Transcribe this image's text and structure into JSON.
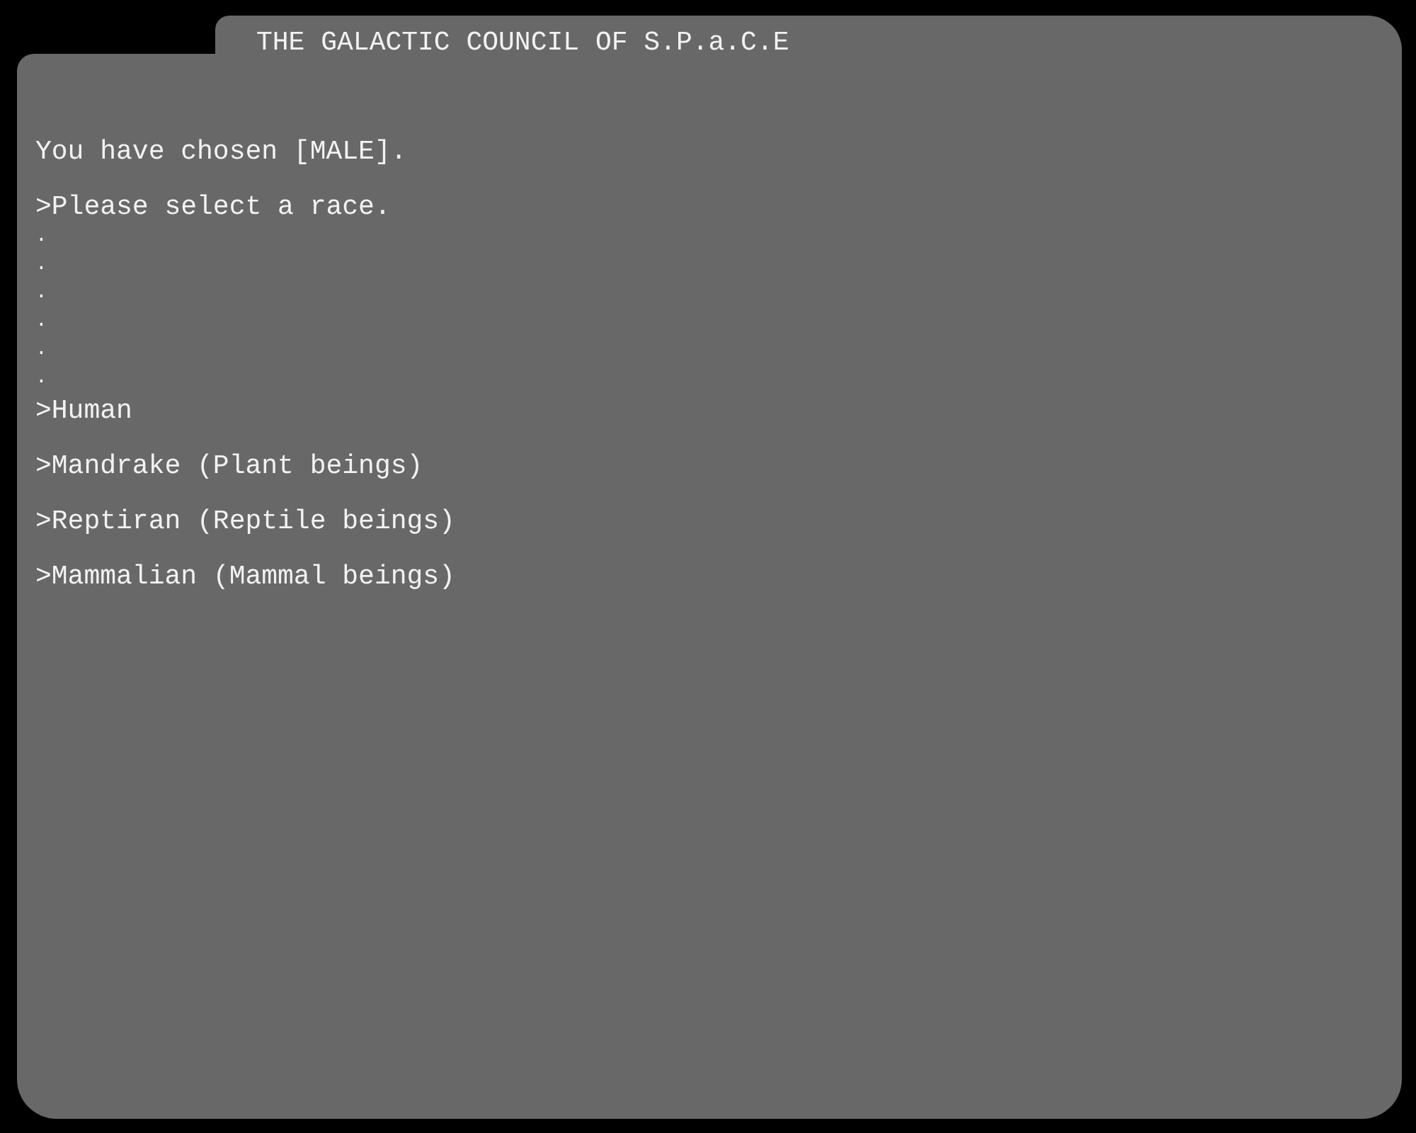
{
  "window": {
    "title": "THE GALACTIC COUNCIL OF S.P.a.C.E"
  },
  "intro": "You have chosen [MALE].",
  "prompt": ">Please select a race.",
  "dots": [
    ".",
    ".",
    ".",
    ".",
    ".",
    "."
  ],
  "options": [
    {
      "label": ">Human"
    },
    {
      "label": ">Mandrake (Plant beings)"
    },
    {
      "label": ">Reptiran (Reptile beings)"
    },
    {
      "label": ">Mammalian (Mammal beings)"
    }
  ]
}
